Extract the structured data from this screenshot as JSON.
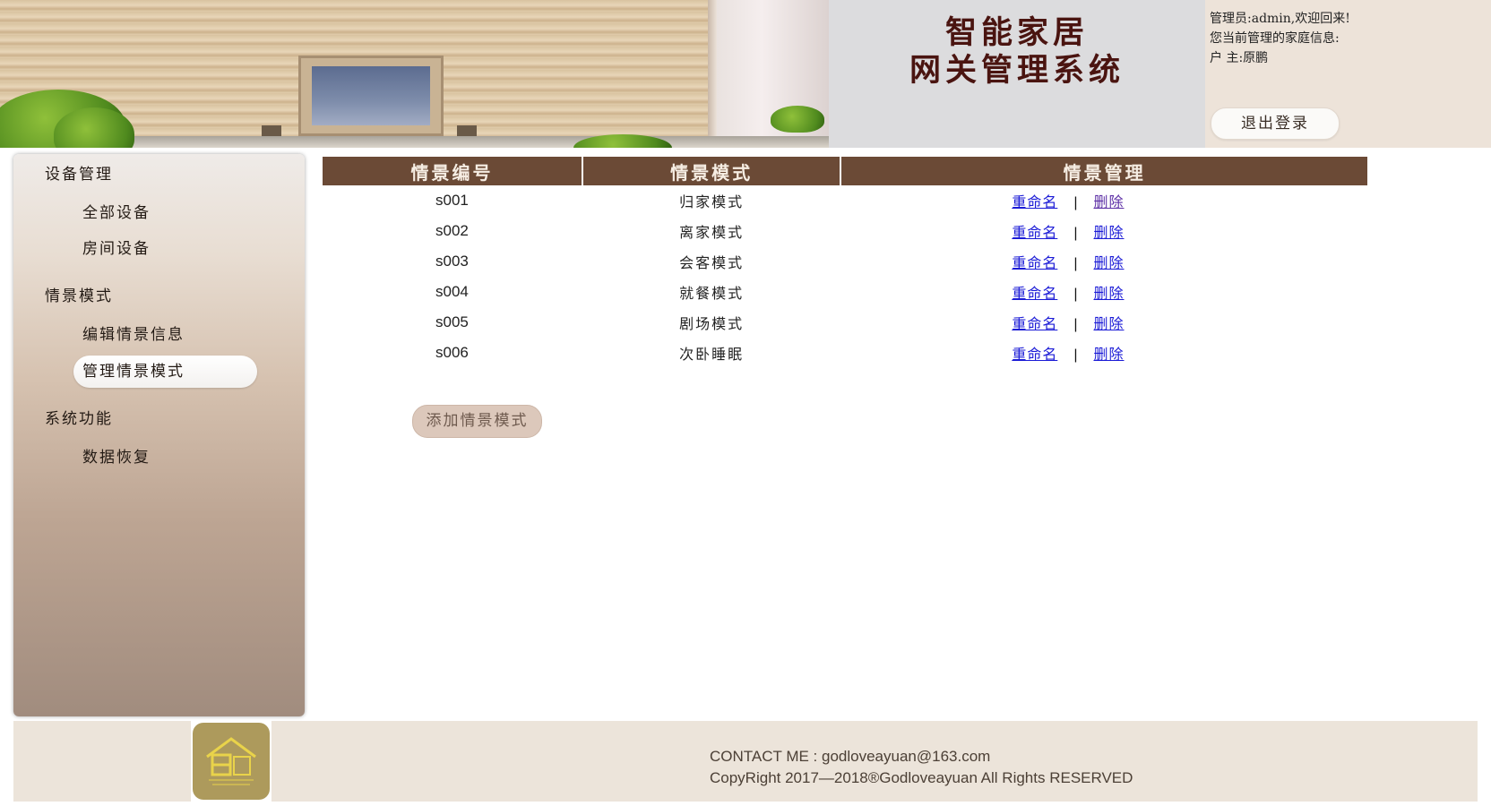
{
  "header": {
    "title_line1": "智能家居",
    "title_line2": "网关管理系统",
    "admin_line": "管理员:admin,欢迎回来!",
    "family_line": "您当前管理的家庭信息:",
    "owner_line": "户  主:原鹏",
    "logout_label": "退出登录"
  },
  "sidebar": {
    "groups": [
      {
        "label": "设备管理",
        "items": [
          {
            "label": "全部设备"
          },
          {
            "label": "房间设备"
          }
        ]
      },
      {
        "label": "情景模式",
        "items": [
          {
            "label": "编辑情景信息"
          },
          {
            "label": "管理情景模式"
          }
        ]
      },
      {
        "label": "系统功能",
        "items": [
          {
            "label": "数据恢复"
          }
        ]
      }
    ],
    "active_item": "管理情景模式"
  },
  "table": {
    "headers": [
      "情景编号",
      "情景模式",
      "情景管理"
    ],
    "rows": [
      {
        "id": "s001",
        "name": "归家模式",
        "rename": "重命名",
        "delete": "删除"
      },
      {
        "id": "s002",
        "name": "离家模式",
        "rename": "重命名",
        "delete": "删除"
      },
      {
        "id": "s003",
        "name": "会客模式",
        "rename": "重命名",
        "delete": "删除"
      },
      {
        "id": "s004",
        "name": "就餐模式",
        "rename": "重命名",
        "delete": "删除"
      },
      {
        "id": "s005",
        "name": "剧场模式",
        "rename": "重命名",
        "delete": "删除"
      },
      {
        "id": "s006",
        "name": "次卧睡眠",
        "rename": "重命名",
        "delete": "删除"
      }
    ],
    "separator": "|"
  },
  "add_button_label": "添加情景模式",
  "footer": {
    "contact": "CONTACT ME : godloveayuan@163.com",
    "copyright": "CopyRight 2017—2018®Godloveayuan All Rights RESERVED"
  },
  "colors": {
    "table_header_bg": "#6b4a36",
    "title_color": "#4a1410",
    "footer_bg": "#ece4da",
    "link_color": "#1a1ad6"
  }
}
